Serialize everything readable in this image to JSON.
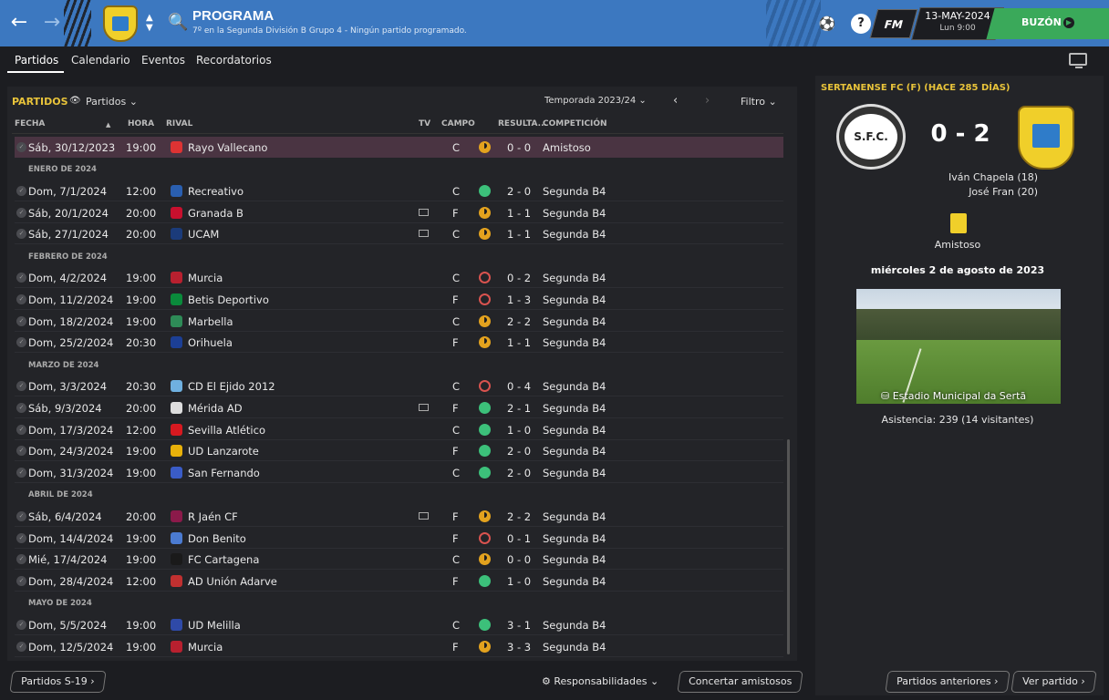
{
  "header": {
    "title": "PROGRAMA",
    "subtitle": "7º en la Segunda División B Grupo 4 - Ningún partido programado.",
    "date": "13-MAY-2024",
    "time": "Lun 9:00",
    "inbox": "BUZÓN",
    "fm": "FM"
  },
  "tabs": [
    "Partidos",
    "Calendario",
    "Eventos",
    "Recordatorios"
  ],
  "panel": {
    "title": "PARTIDOS",
    "filter": "Partidos",
    "season": "Temporada 2023/24",
    "filtro": "Filtro"
  },
  "columns": [
    "FECHA",
    "HORA",
    "RIVAL",
    "TV",
    "CAMPO",
    "RESULTA...",
    "COMPETICIÓN"
  ],
  "months": [
    "ENERO DE 2024",
    "FEBRERO DE 2024",
    "MARZO DE 2024",
    "ABRIL DE 2024",
    "MAYO DE 2024"
  ],
  "rows": [
    {
      "date": "Sáb, 30/12/2023",
      "time": "19:00",
      "rival": "Rayo Vallecano",
      "tv": false,
      "venue": "C",
      "res": "d",
      "score": "0 - 0",
      "comp": "Amistoso",
      "crest": "#d33"
    },
    {
      "date": "Dom, 7/1/2024",
      "time": "12:00",
      "rival": "Recreativo",
      "tv": false,
      "venue": "C",
      "res": "w",
      "score": "2 - 0",
      "comp": "Segunda B4",
      "crest": "#2a5fb0"
    },
    {
      "date": "Sáb, 20/1/2024",
      "time": "20:00",
      "rival": "Granada B",
      "tv": true,
      "venue": "F",
      "res": "d",
      "score": "1 - 1",
      "comp": "Segunda B4",
      "crest": "#c8102e"
    },
    {
      "date": "Sáb, 27/1/2024",
      "time": "20:00",
      "rival": "UCAM",
      "tv": true,
      "venue": "C",
      "res": "d",
      "score": "1 - 1",
      "comp": "Segunda B4",
      "crest": "#1b3b7a"
    },
    {
      "date": "Dom, 4/2/2024",
      "time": "19:00",
      "rival": "Murcia",
      "tv": false,
      "venue": "C",
      "res": "l",
      "score": "0 - 2",
      "comp": "Segunda B4",
      "crest": "#b8202f"
    },
    {
      "date": "Dom, 11/2/2024",
      "time": "19:00",
      "rival": "Betis Deportivo",
      "tv": false,
      "venue": "F",
      "res": "l",
      "score": "1 - 3",
      "comp": "Segunda B4",
      "crest": "#0a8a3b"
    },
    {
      "date": "Dom, 18/2/2024",
      "time": "19:00",
      "rival": "Marbella",
      "tv": false,
      "venue": "C",
      "res": "d",
      "score": "2 - 2",
      "comp": "Segunda B4",
      "crest": "#2e8b57"
    },
    {
      "date": "Dom, 25/2/2024",
      "time": "20:30",
      "rival": "Orihuela",
      "tv": false,
      "venue": "F",
      "res": "d",
      "score": "1 - 1",
      "comp": "Segunda B4",
      "crest": "#1c3f95"
    },
    {
      "date": "Dom, 3/3/2024",
      "time": "20:30",
      "rival": "CD El Ejido 2012",
      "tv": false,
      "venue": "C",
      "res": "l",
      "score": "0 - 4",
      "comp": "Segunda B4",
      "crest": "#6fb0e0"
    },
    {
      "date": "Sáb, 9/3/2024",
      "time": "20:00",
      "rival": "Mérida AD",
      "tv": true,
      "venue": "F",
      "res": "w",
      "score": "2 - 1",
      "comp": "Segunda B4",
      "crest": "#ddd"
    },
    {
      "date": "Dom, 17/3/2024",
      "time": "12:00",
      "rival": "Sevilla Atlético",
      "tv": false,
      "venue": "C",
      "res": "w",
      "score": "1 - 0",
      "comp": "Segunda B4",
      "crest": "#d71920"
    },
    {
      "date": "Dom, 24/3/2024",
      "time": "19:00",
      "rival": "UD Lanzarote",
      "tv": false,
      "venue": "F",
      "res": "w",
      "score": "2 - 0",
      "comp": "Segunda B4",
      "crest": "#e8b10a"
    },
    {
      "date": "Dom, 31/3/2024",
      "time": "19:00",
      "rival": "San Fernando",
      "tv": false,
      "venue": "C",
      "res": "w",
      "score": "2 - 0",
      "comp": "Segunda B4",
      "crest": "#3a5cc7"
    },
    {
      "date": "Sáb, 6/4/2024",
      "time": "20:00",
      "rival": "R Jaén CF",
      "tv": true,
      "venue": "F",
      "res": "d",
      "score": "2 - 2",
      "comp": "Segunda B4",
      "crest": "#8b1a4a"
    },
    {
      "date": "Dom, 14/4/2024",
      "time": "19:00",
      "rival": "Don Benito",
      "tv": false,
      "venue": "F",
      "res": "l",
      "score": "0 - 1",
      "comp": "Segunda B4",
      "crest": "#4b7bd1"
    },
    {
      "date": "Mié, 17/4/2024",
      "time": "19:00",
      "rival": "FC Cartagena",
      "tv": false,
      "venue": "C",
      "res": "d",
      "score": "0 - 0",
      "comp": "Segunda B4",
      "crest": "#1a1a1a"
    },
    {
      "date": "Dom, 28/4/2024",
      "time": "12:00",
      "rival": "AD Unión Adarve",
      "tv": false,
      "venue": "F",
      "res": "w",
      "score": "1 - 0",
      "comp": "Segunda B4",
      "crest": "#c03030"
    },
    {
      "date": "Dom, 5/5/2024",
      "time": "19:00",
      "rival": "UD Melilla",
      "tv": false,
      "venue": "C",
      "res": "w",
      "score": "3 - 1",
      "comp": "Segunda B4",
      "crest": "#2f4aa8"
    },
    {
      "date": "Dom, 12/5/2024",
      "time": "19:00",
      "rival": "Murcia",
      "tv": false,
      "venue": "F",
      "res": "d",
      "score": "3 - 3",
      "comp": "Segunda B4",
      "crest": "#b8202f"
    }
  ],
  "bottom": {
    "youth": "Partidos S-19",
    "resp": "Responsabilidades",
    "friendly": "Concertar amistosos",
    "prev": "Partidos anteriores",
    "view": "Ver partido"
  },
  "match": {
    "title": "SERTANENSE FC (F)  (HACE 285 DÍAS)",
    "home_abbr": "S.F.C.",
    "score": "0 - 2",
    "scorers": [
      "Iván Chapela (18)",
      "José Fran (20)"
    ],
    "competition": "Amistoso",
    "date": "miércoles 2 de agosto de 2023",
    "stadium": "Estadio Municipal da Sertã",
    "attendance": "Asistencia: 239 (14 visitantes)"
  }
}
